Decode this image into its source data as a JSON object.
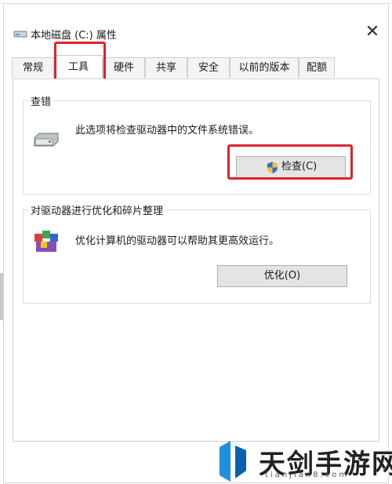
{
  "window": {
    "title": "本地磁盘 (C:) 属性",
    "close_glyph": "✕"
  },
  "tabs": [
    "常规",
    "工具",
    "硬件",
    "共享",
    "安全",
    "以前的版本",
    "配额"
  ],
  "active_tab": "工具",
  "error_check": {
    "label": "查错",
    "description": "此选项将检查驱动器中的文件系统错误。",
    "button": "检查(C)",
    "button_icon": "uac-shield-icon"
  },
  "optimize": {
    "label": "对驱动器进行优化和碎片整理",
    "description": "优化计算机的驱动器可以帮助其更高效运行。",
    "button": "优化(O)"
  },
  "watermark": {
    "text": "天剑手游网",
    "sub": "tianjian8.com"
  },
  "colors": {
    "highlight": "#d9262b",
    "button_bg": "#e4e4e4",
    "border": "#cfcfcf"
  }
}
